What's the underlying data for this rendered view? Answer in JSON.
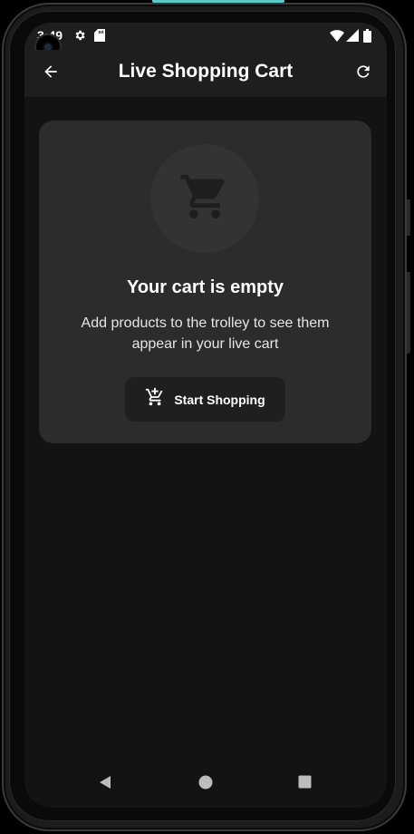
{
  "status_bar": {
    "time": "3:49",
    "icons": [
      "settings-icon",
      "sd-card-icon",
      "wifi-icon",
      "signal-icon",
      "battery-icon"
    ]
  },
  "app_bar": {
    "title": "Live Shopping Cart",
    "back_icon": "arrow-left-icon",
    "refresh_icon": "refresh-icon"
  },
  "empty_state": {
    "icon": "shopping-cart-icon",
    "title": "Your cart is empty",
    "message": "Add products to the trolley to see them appear in your live cart",
    "button": {
      "label": "Start Shopping",
      "icon": "add-to-cart-icon"
    }
  },
  "nav_bar": {
    "buttons": [
      "back-triangle-icon",
      "home-circle-icon",
      "recents-square-icon"
    ]
  },
  "colors": {
    "background": "#131313",
    "card": "#2c2c2c",
    "app_bar": "#1e1e1e",
    "accent": "#5ec8c8",
    "text": "#ffffff"
  }
}
